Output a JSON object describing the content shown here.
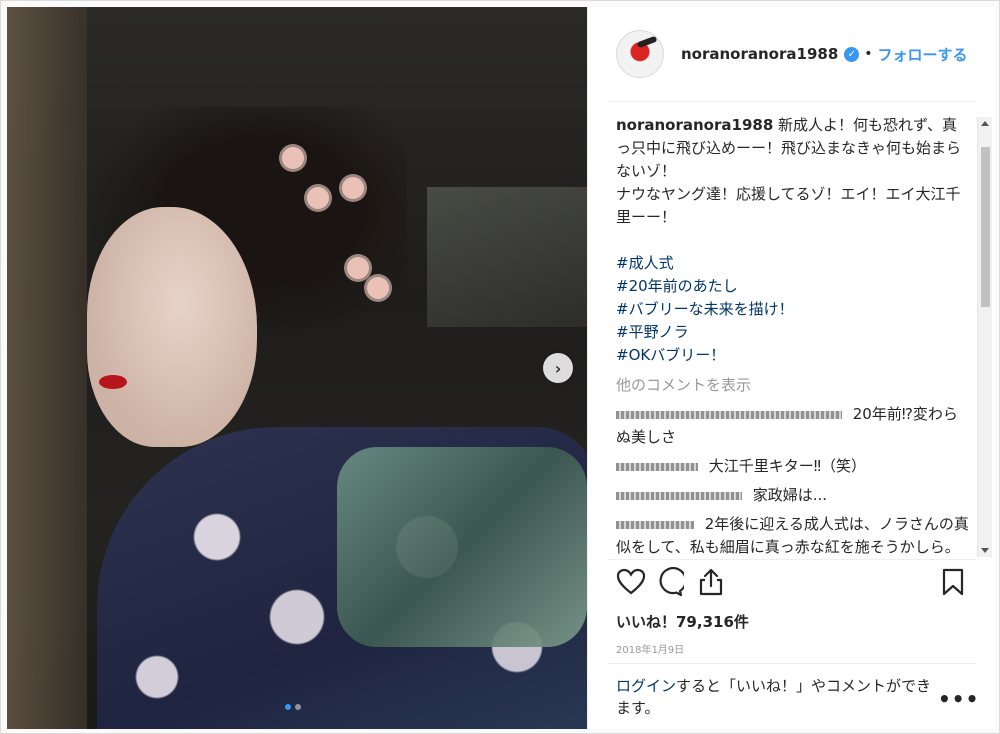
{
  "post": {
    "username": "noranoranora1988",
    "verified_glyph": "✓",
    "separator": "•",
    "follow_label": "フォローする",
    "caption_user": "noranoranora1988",
    "caption_text": " 新成人よ！何も恐れず、真っ只中に飛び込めーー！飛び込まなきゃ何も始まらないゾ！\nナウなヤング達！応援してるゾ！エイ！エイ大江千里ーー！",
    "hashtags": [
      "#成人式",
      "#20年前のあたし",
      "#バブリーな未来を描け！",
      "#平野ノラ",
      "#OKバブリー！"
    ],
    "view_more": "他のコメントを表示",
    "comments": [
      {
        "text": " 20年前⁉変わらぬ美しさ"
      },
      {
        "text": " 大江千里キター‼（笑）"
      },
      {
        "text": " 家政婦は..."
      },
      {
        "text": " 2年後に迎える成人式は、ノラさんの真似をして、私も細眉に真っ赤な紅を施そうかしら。オッケイバブリー！"
      }
    ],
    "likes": "いいね！79,316件",
    "date": "2018年1月9日",
    "login_link": "ログイン",
    "login_text": "すると「いいね！」やコメントができます。",
    "more_label": "•••"
  },
  "carousel": {
    "next_glyph": "›",
    "slide_count": 2,
    "active_index": 1
  },
  "icons": {
    "like": "heart-outline-icon",
    "comment": "speech-bubble-icon",
    "share": "share-upload-icon",
    "save": "bookmark-icon"
  },
  "colors": {
    "link_blue": "#3897f0",
    "hashtag": "#003569",
    "muted": "#999999"
  }
}
